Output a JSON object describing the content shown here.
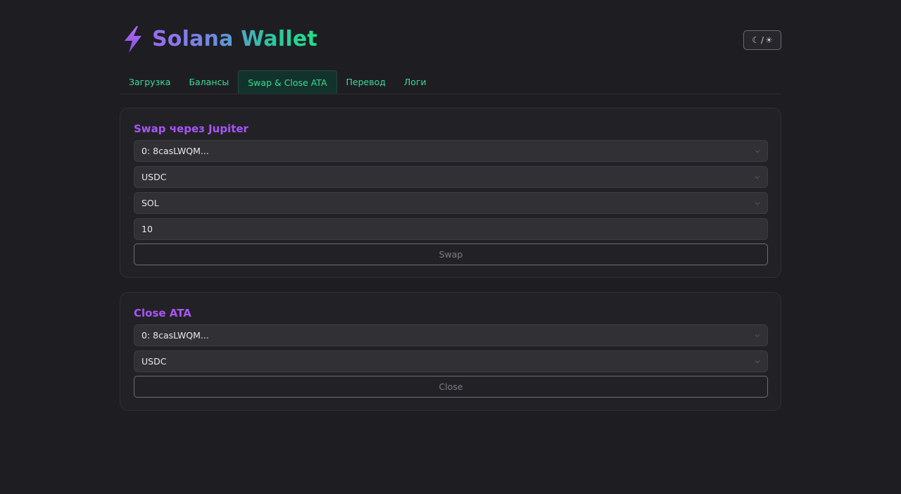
{
  "header": {
    "icon": "lightning-bolt-icon",
    "title": "Solana Wallet",
    "theme_toggle": {
      "moon_icon": "☾",
      "separator": "/",
      "sun_icon": "☀"
    }
  },
  "tabs": [
    {
      "label": "Загрузка"
    },
    {
      "label": "Балансы"
    },
    {
      "label": "Swap & Close ATA",
      "active": true
    },
    {
      "label": "Перевод"
    },
    {
      "label": "Логи"
    }
  ],
  "swap_card": {
    "title": "Swap через Jupiter",
    "wallet_select": "0: 8casLWQM...",
    "from_token_select": "USDC",
    "to_token_select": "SOL",
    "amount_input": "10",
    "button_label": "Swap"
  },
  "close_card": {
    "title": "Close ATA",
    "wallet_select": "0: 8casLWQM...",
    "token_select": "USDC",
    "button_label": "Close"
  },
  "colors": {
    "background": "#1e1e22",
    "accent_green": "#3ddc97",
    "accent_purple": "#a855f7"
  }
}
